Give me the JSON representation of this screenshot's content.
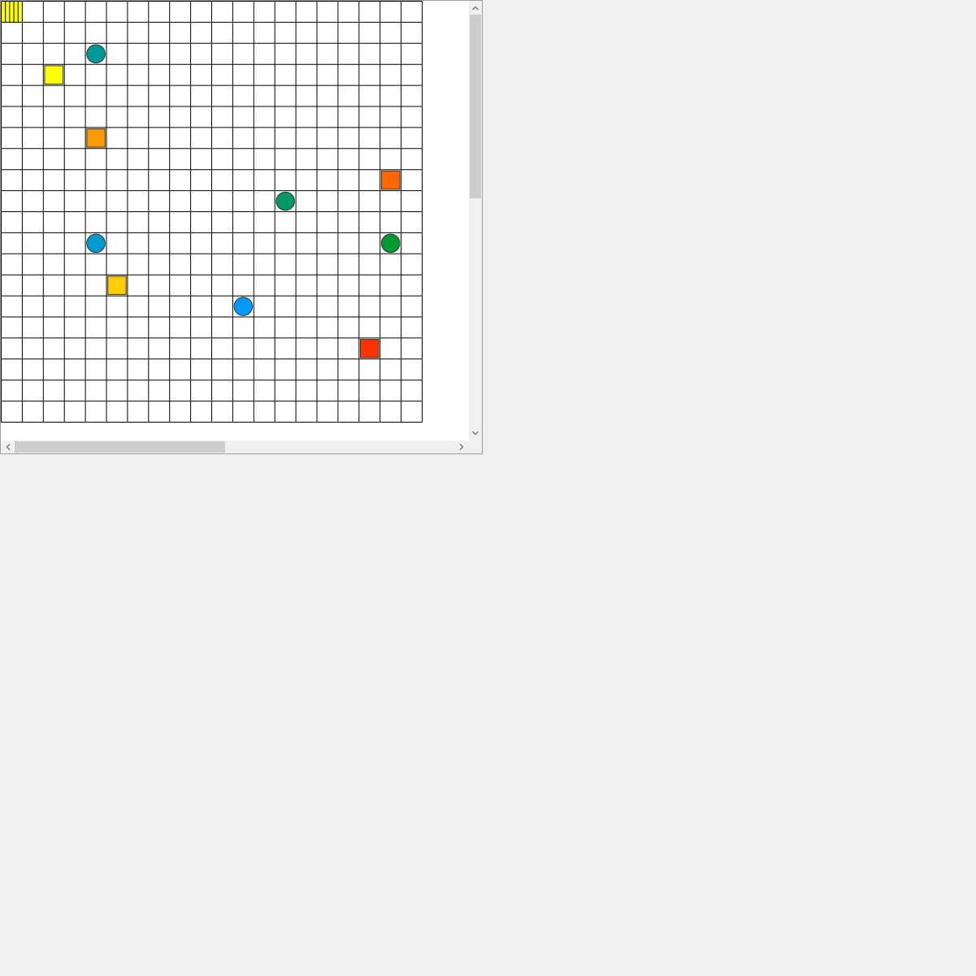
{
  "board": {
    "columns": 20,
    "rows": 20,
    "grid_line_color": "#000000",
    "cell_fill": "#ffffff",
    "cursor": {
      "col": 0,
      "row": 0,
      "fill": "#ffff00",
      "pattern": "vertical-stripes"
    },
    "pieces": [
      {
        "id": "circle-teal",
        "shape": "circle",
        "col": 4,
        "row": 2,
        "color": "#009999"
      },
      {
        "id": "square-yellow",
        "shape": "square",
        "col": 2,
        "row": 3,
        "color": "#ffff00"
      },
      {
        "id": "square-orange",
        "shape": "square",
        "col": 4,
        "row": 6,
        "color": "#ff9900"
      },
      {
        "id": "square-dark-orange",
        "shape": "square",
        "col": 18,
        "row": 8,
        "color": "#ff6600"
      },
      {
        "id": "circle-sea-green",
        "shape": "circle",
        "col": 13,
        "row": 9,
        "color": "#009966"
      },
      {
        "id": "circle-light-blue",
        "shape": "circle",
        "col": 4,
        "row": 11,
        "color": "#0099cc"
      },
      {
        "id": "circle-green",
        "shape": "circle",
        "col": 18,
        "row": 11,
        "color": "#009933"
      },
      {
        "id": "square-amber",
        "shape": "square",
        "col": 5,
        "row": 13,
        "color": "#ffcc00"
      },
      {
        "id": "circle-blue",
        "shape": "circle",
        "col": 11,
        "row": 14,
        "color": "#0099ff"
      },
      {
        "id": "square-red",
        "shape": "square",
        "col": 17,
        "row": 16,
        "color": "#ff3300"
      }
    ]
  },
  "scrollbars": {
    "vertical": {
      "up_icon": "chevron-up-icon",
      "down_icon": "chevron-down-icon",
      "position": 0.0,
      "visible_fraction": 0.43
    },
    "horizontal": {
      "left_icon": "chevron-left-icon",
      "right_icon": "chevron-right-icon",
      "position": 0.0,
      "visible_fraction": 0.48
    }
  }
}
